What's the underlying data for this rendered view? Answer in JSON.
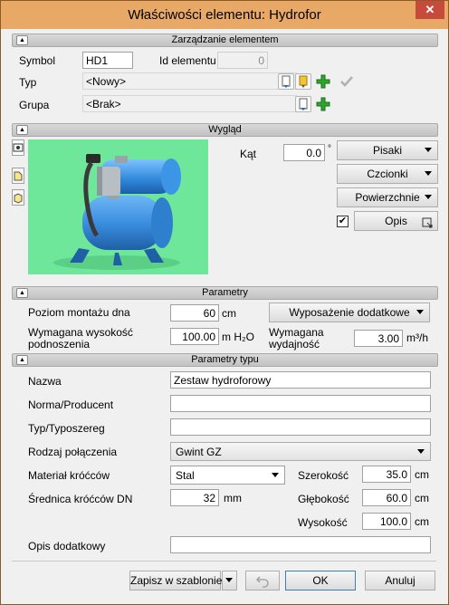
{
  "window": {
    "title": "Właściwości elementu: Hydrofor",
    "close_glyph": "✕"
  },
  "section_management": {
    "header": "Zarządzanie elementem",
    "symbol_label": "Symbol",
    "symbol_value": "HD1",
    "id_label": "Id elementu",
    "id_value": "0",
    "type_label": "Typ",
    "type_value": "<Nowy>",
    "group_label": "Grupa",
    "group_value": "<Brak>"
  },
  "section_appearance": {
    "header": "Wygląd",
    "angle_label": "Kąt",
    "angle_value": "0.0",
    "angle_unit": "°",
    "pens_label": "Pisaki",
    "fonts_label": "Czcionki",
    "surfaces_label": "Powierzchnie",
    "description_label": "Opis",
    "description_checked": true
  },
  "section_parameters": {
    "header": "Parametry",
    "mount_level_label": "Poziom montażu dna",
    "mount_level_value": "60",
    "mount_level_unit": "cm",
    "extra_equipment_label": "Wyposażenie dodatkowe",
    "lift_height_label": "Wymagana wysokość podnoszenia",
    "lift_height_value": "100.00",
    "lift_height_unit": "m H₂O",
    "capacity_label": "Wymagana wydajność",
    "capacity_value": "3.00",
    "capacity_unit": "m³/h"
  },
  "section_type_params": {
    "header": "Parametry typu",
    "name_label": "Nazwa",
    "name_value": "Zestaw hydroforowy",
    "standard_label": "Norma/Producent",
    "standard_value": "",
    "series_label": "Typ/Typoszereg",
    "series_value": "",
    "connection_label": "Rodzaj połączenia",
    "connection_value": "Gwint GZ",
    "stub_material_label": "Materiał króćców",
    "stub_material_value": "Stal",
    "stub_diameter_label": "Średnica króćców DN",
    "stub_diameter_value": "32",
    "stub_diameter_unit": "mm",
    "width_label": "Szerokość",
    "width_value": "35.0",
    "depth_label": "Głębokość",
    "depth_value": "60.0",
    "height_label": "Wysokość",
    "height_value": "100.0",
    "dim_unit": "cm",
    "extra_desc_label": "Opis dodatkowy",
    "extra_desc_value": ""
  },
  "footer": {
    "save_template_label": "Zapisz w szablonie",
    "ok_label": "OK",
    "cancel_label": "Anuluj"
  },
  "colors": {
    "titlebar": "#e8a866",
    "close_button": "#c74b3c",
    "preview_bg": "#6fe79a",
    "pump_blue": "#3b8fe0",
    "add_green": "#2ea52e"
  }
}
